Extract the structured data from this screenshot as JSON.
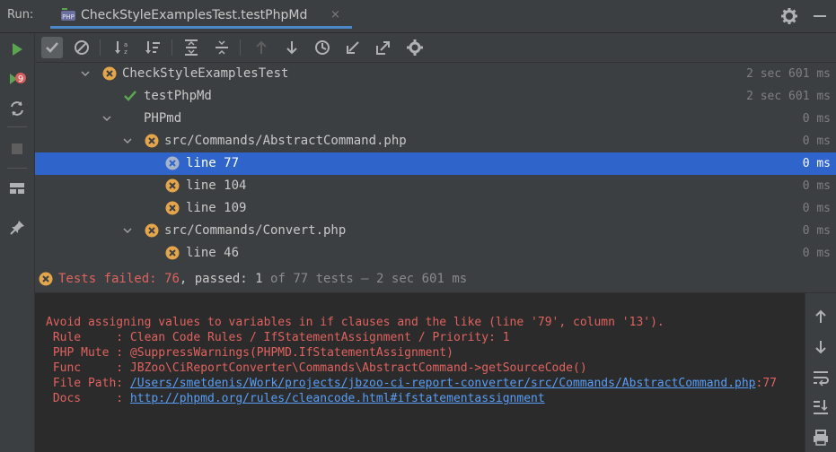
{
  "header": {
    "run_label": "Run:",
    "tab_title": "CheckStyleExamplesTest.testPhpMd",
    "tab_icon": "php-test-icon",
    "tab_close": "×"
  },
  "tree": {
    "rows": [
      {
        "label": "CheckStyleExamplesTest",
        "time": "2 sec 601 ms",
        "status": "failed"
      },
      {
        "label": "testPhpMd",
        "time": "2 sec 601 ms",
        "status": "passed"
      },
      {
        "label": "PHPmd",
        "time": "0 ms",
        "status": "none"
      },
      {
        "label": "src/Commands/AbstractCommand.php",
        "time": "0 ms",
        "status": "failed"
      },
      {
        "label": "line 77",
        "time": "0 ms",
        "status": "failed",
        "selected": true
      },
      {
        "label": "line 104",
        "time": "0 ms",
        "status": "failed"
      },
      {
        "label": "line 109",
        "time": "0 ms",
        "status": "failed"
      },
      {
        "label": "src/Commands/Convert.php",
        "time": "0 ms",
        "status": "failed"
      },
      {
        "label": "line 46",
        "time": "0 ms",
        "status": "failed"
      }
    ]
  },
  "status": {
    "failed_label": "Tests failed: ",
    "failed_count": "76",
    "passed_label": ", passed: ",
    "passed_count": "1",
    "rest": " of 77 tests – 2 sec 601 ms"
  },
  "console": {
    "message": "Avoid assigning values to variables in if clauses and the like (line '79', column '13').",
    "rule_key": " Rule     : ",
    "rule_value": "Clean Code Rules / IfStatementAssignment / Priority: 1",
    "mute_key": " PHP Mute : ",
    "mute_value": "@SuppressWarnings(PHPMD.IfStatementAssignment)",
    "func_key": " Func     : ",
    "func_value": "JBZoo\\CiReportConverter\\Commands\\AbstractCommand->getSourceCode()",
    "path_key": " File Path: ",
    "path_link": "/Users/smetdenis/Work/projects/jbzoo-ci-report-converter/src/Commands/AbstractCommand.php",
    "path_suffix": ":77",
    "docs_key": " Docs     : ",
    "docs_link": "http://phpmd.org/rules/cleancode.html#ifstatementassignment"
  },
  "colors": {
    "accent": "#2f65ca",
    "failed": "#e0625f",
    "passed": "#5aa452",
    "warning_icon": "#e5a54b",
    "link": "#589df6"
  }
}
